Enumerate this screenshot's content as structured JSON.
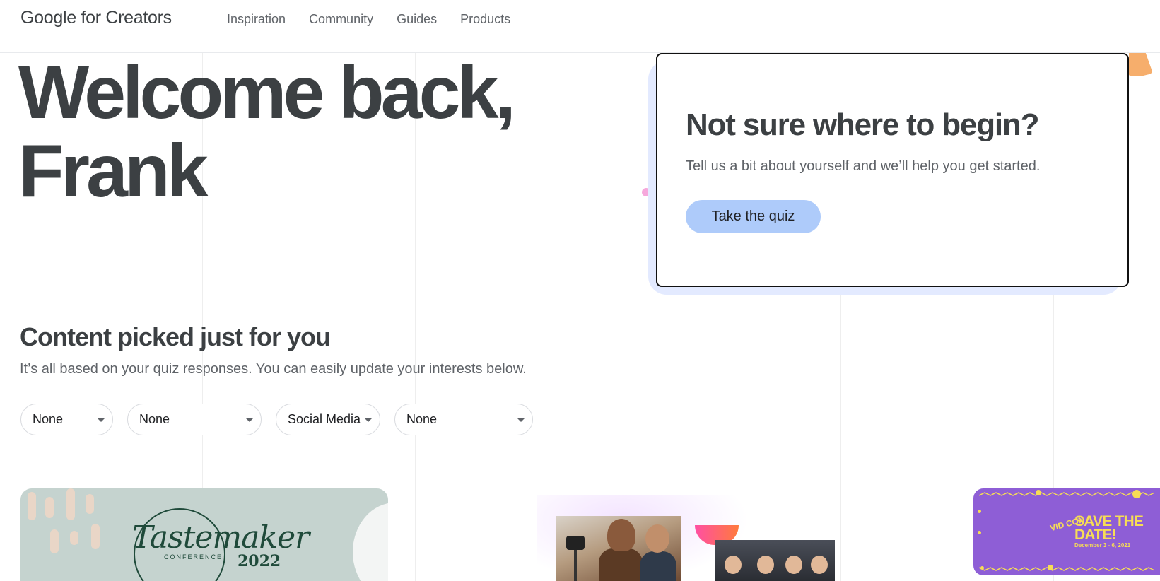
{
  "header": {
    "logo": "Google for Creators",
    "nav": [
      "Inspiration",
      "Community",
      "Guides",
      "Products"
    ]
  },
  "hero": {
    "line1": "Welcome back,",
    "line2": "Frank"
  },
  "quiz": {
    "title": "Not sure where to begin?",
    "subtitle": "Tell us a bit about yourself and we’ll help you get started.",
    "button": "Take the quiz"
  },
  "content": {
    "title": "Content picked just for you",
    "subtitle": "It’s all based on your quiz responses. You can easily update your interests below.",
    "filters": [
      "None",
      "None",
      "Social Media",
      "None"
    ]
  },
  "cards": {
    "tastemaker": {
      "title": "Tastemaker",
      "subtitle": "CONFERENCE",
      "year": "2022"
    },
    "vidcon": {
      "logo": "VID CON",
      "headline_line1": "SAVE THE",
      "headline_line2": "DATE!",
      "dates": "December 3 - 6, 2021"
    }
  },
  "colors": {
    "accent_button": "#aecbfa",
    "quiz_shadow": "#e3eaff",
    "vidcon_purple": "#8e5ed6",
    "vidcon_yellow": "#f7dd55",
    "tastemaker_bg": "#c5d3cf"
  }
}
